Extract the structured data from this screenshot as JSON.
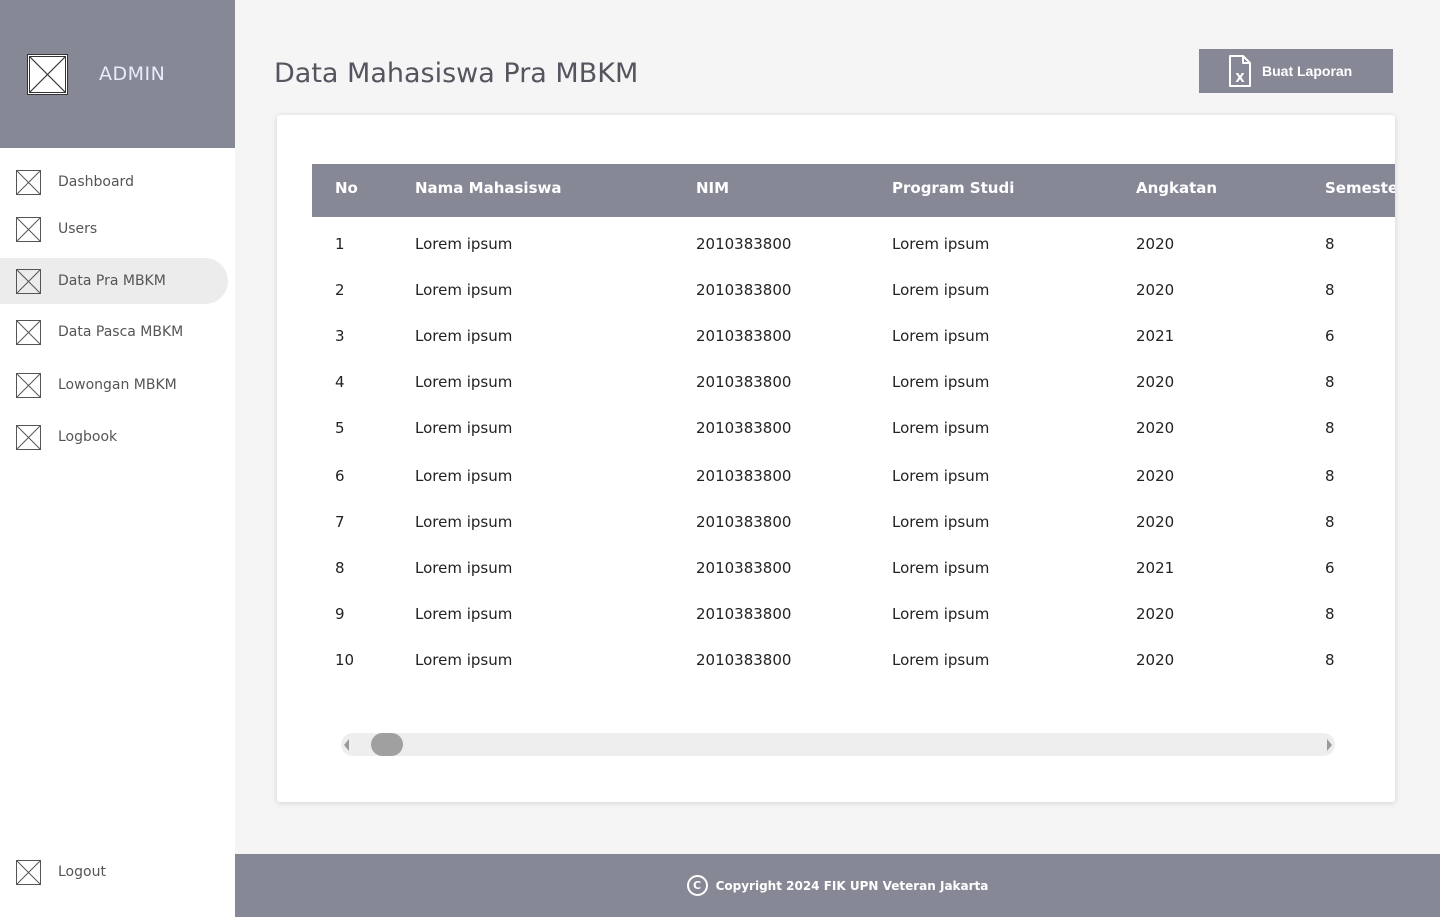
{
  "sidebar": {
    "brand": "ADMIN",
    "items": [
      {
        "label": "Dashboard",
        "icon": "placeholder-image-icon"
      },
      {
        "label": "Users",
        "icon": "placeholder-image-icon"
      },
      {
        "label": "Data Pra MBKM",
        "icon": "placeholder-image-icon",
        "active": true
      },
      {
        "label": "Data Pasca MBKM",
        "icon": "placeholder-image-icon"
      },
      {
        "label": "Lowongan MBKM",
        "icon": "placeholder-image-icon"
      },
      {
        "label": "Logbook",
        "icon": "placeholder-image-icon"
      }
    ],
    "logout": "Logout"
  },
  "main": {
    "title": "Data Mahasiswa Pra MBKM",
    "report_button": "Buat Laporan"
  },
  "table": {
    "columns": [
      "No",
      "Nama Mahasiswa",
      "NIM",
      "Program Studi",
      "Angkatan",
      "Semester"
    ],
    "rows": [
      [
        "1",
        "Lorem ipsum",
        "2010383800",
        "Lorem ipsum",
        "2020",
        "8"
      ],
      [
        "2",
        "Lorem ipsum",
        "2010383800",
        "Lorem ipsum",
        "2020",
        "8"
      ],
      [
        "3",
        "Lorem ipsum",
        "2010383800",
        "Lorem ipsum",
        "2021",
        "6"
      ],
      [
        "4",
        "Lorem ipsum",
        "2010383800",
        "Lorem ipsum",
        "2020",
        "8"
      ],
      [
        "5",
        "Lorem ipsum",
        "2010383800",
        "Lorem ipsum",
        "2020",
        "8"
      ],
      [
        "6",
        "Lorem ipsum",
        "2010383800",
        "Lorem ipsum",
        "2020",
        "8"
      ],
      [
        "7",
        "Lorem ipsum",
        "2010383800",
        "Lorem ipsum",
        "2020",
        "8"
      ],
      [
        "8",
        "Lorem ipsum",
        "2010383800",
        "Lorem ipsum",
        "2021",
        "6"
      ],
      [
        "9",
        "Lorem ipsum",
        "2010383800",
        "Lorem ipsum",
        "2020",
        "8"
      ],
      [
        "10",
        "Lorem ipsum",
        "2010383800",
        "Lorem ipsum",
        "2020",
        "8"
      ]
    ]
  },
  "footer": {
    "text": "Copyright 2024 FIK UPN Veteran Jakarta",
    "icon": "copyright-icon"
  },
  "colors": {
    "primary": "#878896",
    "background": "#f5f5f5",
    "active_nav": "#ececec",
    "brand_text": "#e6ecfa"
  }
}
